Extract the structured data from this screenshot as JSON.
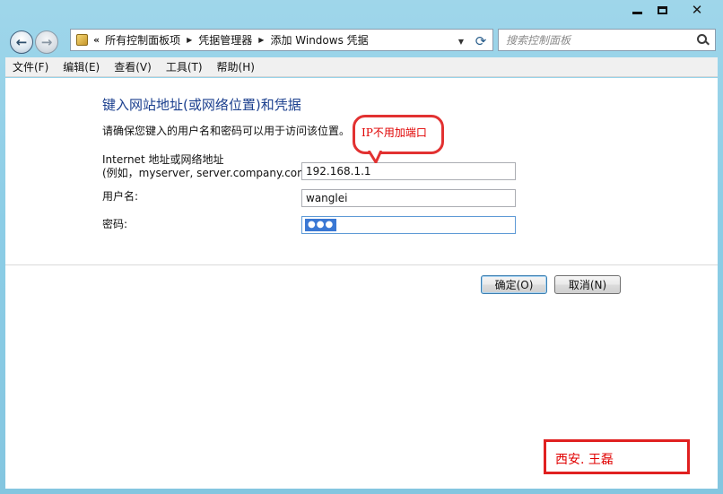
{
  "window": {
    "controls": {
      "minimize": "",
      "maximize": "",
      "close": "✕"
    }
  },
  "navigation": {
    "back_glyph": "←",
    "forward_glyph": "→",
    "breadcrumb_prefix": "«",
    "breadcrumbs": [
      "所有控制面板项",
      "凭据管理器",
      "添加 Windows 凭据"
    ],
    "search_placeholder": "搜索控制面板"
  },
  "menu": [
    "文件(F)",
    "编辑(E)",
    "查看(V)",
    "工具(T)",
    "帮助(H)"
  ],
  "form": {
    "heading": "键入网站地址(或网络位置)和凭据",
    "instruction": "请确保您键入的用户名和密码可以用于访问该位置。",
    "address_label_line1": "Internet 地址或网络地址",
    "address_label_line2": "(例如，myserver, server.company.com):",
    "address_value": "192.168.1.1",
    "username_label": "用户名:",
    "username_value": "wanglei",
    "password_label": "密码:",
    "password_mask": "●●●"
  },
  "buttons": {
    "ok": "确定(O)",
    "cancel": "取消(N)"
  },
  "annotations": {
    "callout": "IP不用加端口",
    "signature": "西安. 王磊"
  },
  "colors": {
    "frame": "#8ccde6",
    "heading": "#1b3f8e",
    "annotation_red": "#e02020",
    "selection_blue": "#3a78d4"
  }
}
